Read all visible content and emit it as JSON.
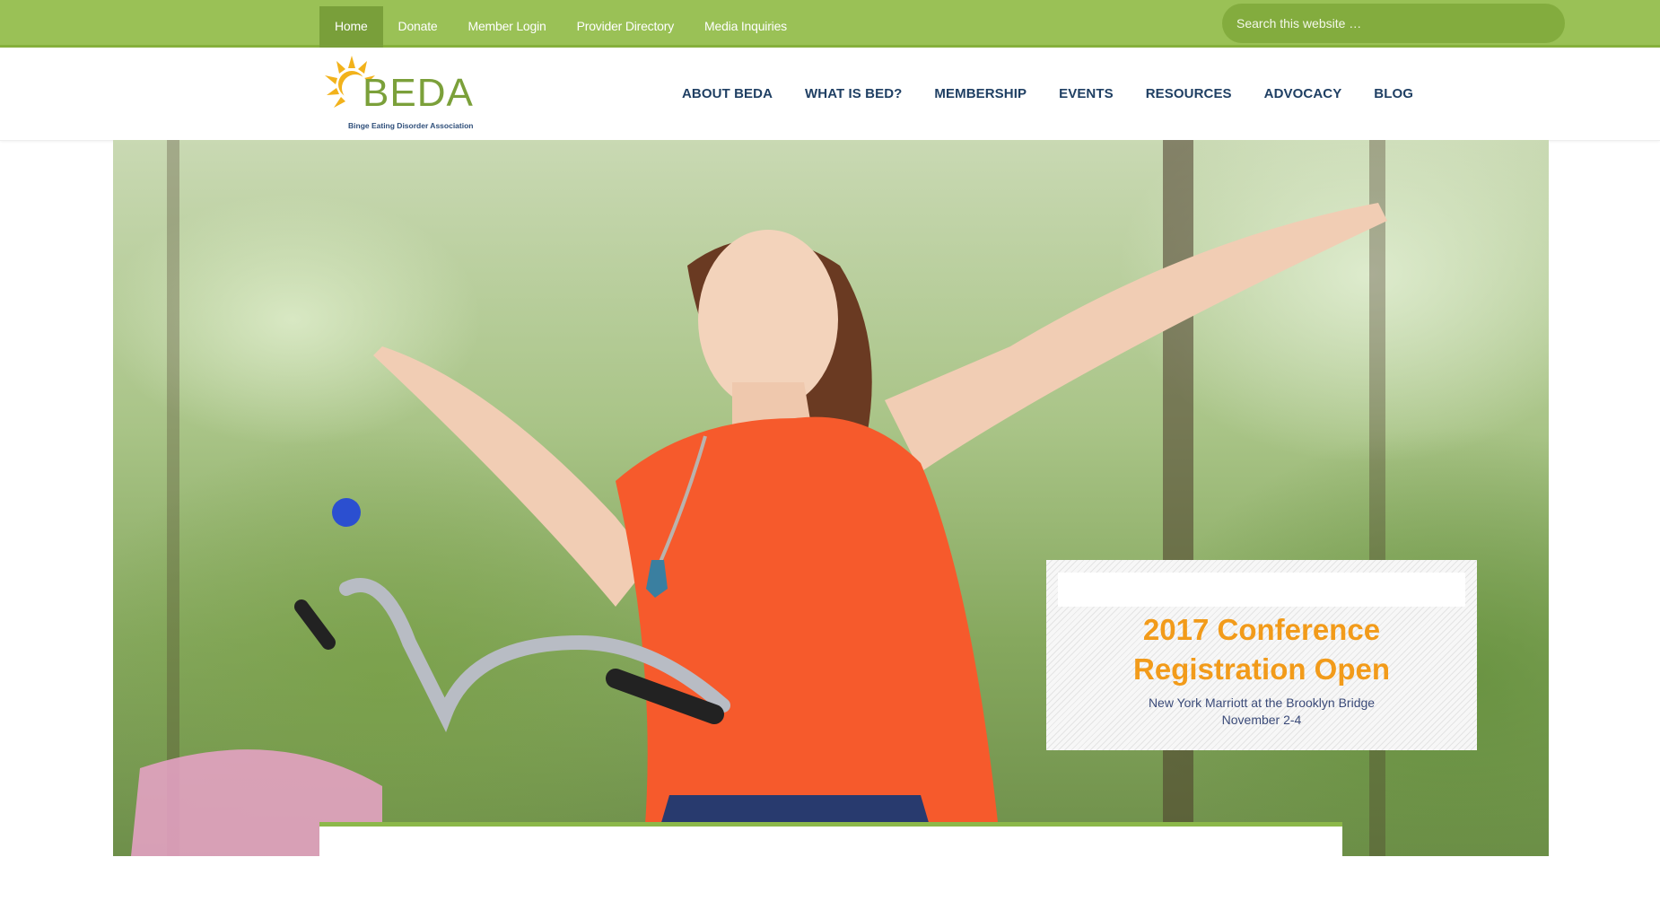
{
  "topbar": {
    "nav": [
      {
        "label": "Home",
        "active": true
      },
      {
        "label": "Donate",
        "active": false
      },
      {
        "label": "Member Login",
        "active": false
      },
      {
        "label": "Provider Directory",
        "active": false
      },
      {
        "label": "Media Inquiries",
        "active": false
      }
    ],
    "search_placeholder": "Search this website …"
  },
  "header": {
    "logo": {
      "name": "BEDA",
      "tagline": "Binge Eating Disorder Association",
      "icon": "sun-icon"
    },
    "nav": [
      {
        "label": "ABOUT BEDA"
      },
      {
        "label": "WHAT IS BED?"
      },
      {
        "label": "MEMBERSHIP"
      },
      {
        "label": "EVENTS"
      },
      {
        "label": "RESOURCES"
      },
      {
        "label": "ADVOCACY"
      },
      {
        "label": "BLOG"
      }
    ]
  },
  "hero": {
    "promo": {
      "title": "2017 Conference Registration Open",
      "venue": "New York Marriott at the Brooklyn Bridge",
      "dates": "November 2-4"
    }
  },
  "colors": {
    "brand_green": "#9ac156",
    "active_green": "#799f3a",
    "nav_text": "#1f3f63",
    "promo_orange": "#f29b1a",
    "promo_subtext": "#3a4a78"
  }
}
